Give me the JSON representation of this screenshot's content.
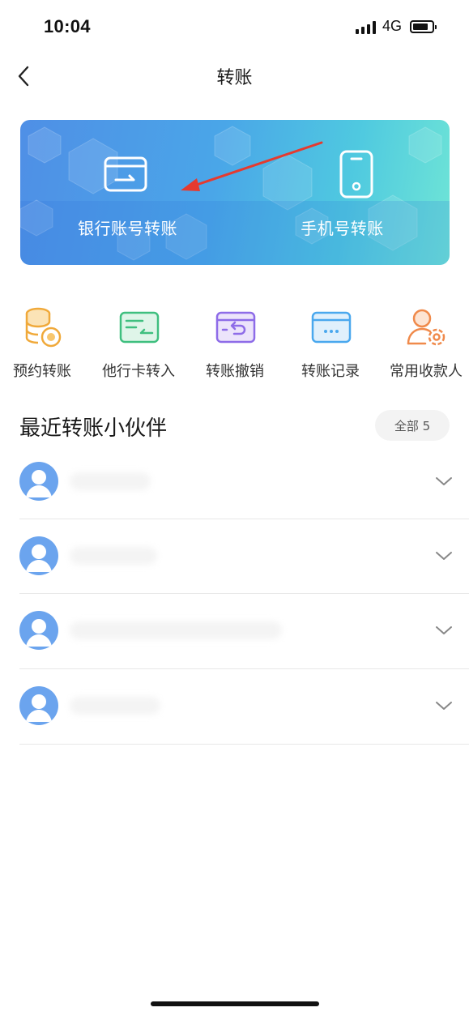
{
  "status_bar": {
    "time": "10:04",
    "network": "4G"
  },
  "nav": {
    "title": "转账",
    "back_icon": "chevron-left-icon"
  },
  "banner": {
    "left": {
      "label": "银行账号转账",
      "icon": "bank-card-icon"
    },
    "right": {
      "label": "手机号转账",
      "icon": "mobile-phone-icon"
    }
  },
  "quick_actions": [
    {
      "label": "预约转账",
      "icon": "coin-stack-icon",
      "color": "#f0a93a"
    },
    {
      "label": "他行卡转入",
      "icon": "card-transfer-in-icon",
      "color": "#3fbf7f"
    },
    {
      "label": "转账撤销",
      "icon": "card-undo-icon",
      "color": "#8e6ce8"
    },
    {
      "label": "转账记录",
      "icon": "card-record-icon",
      "color": "#4aa8ee"
    },
    {
      "label": "常用收款人",
      "icon": "payee-gear-icon",
      "color": "#f08a4b"
    }
  ],
  "recent": {
    "title": "最近转账小伙伴",
    "all_label": "全部 5"
  },
  "colors": {
    "accent": "#4f8fe6",
    "avatar": "#6ba4ee",
    "annotation_arrow": "#e53a2f"
  }
}
